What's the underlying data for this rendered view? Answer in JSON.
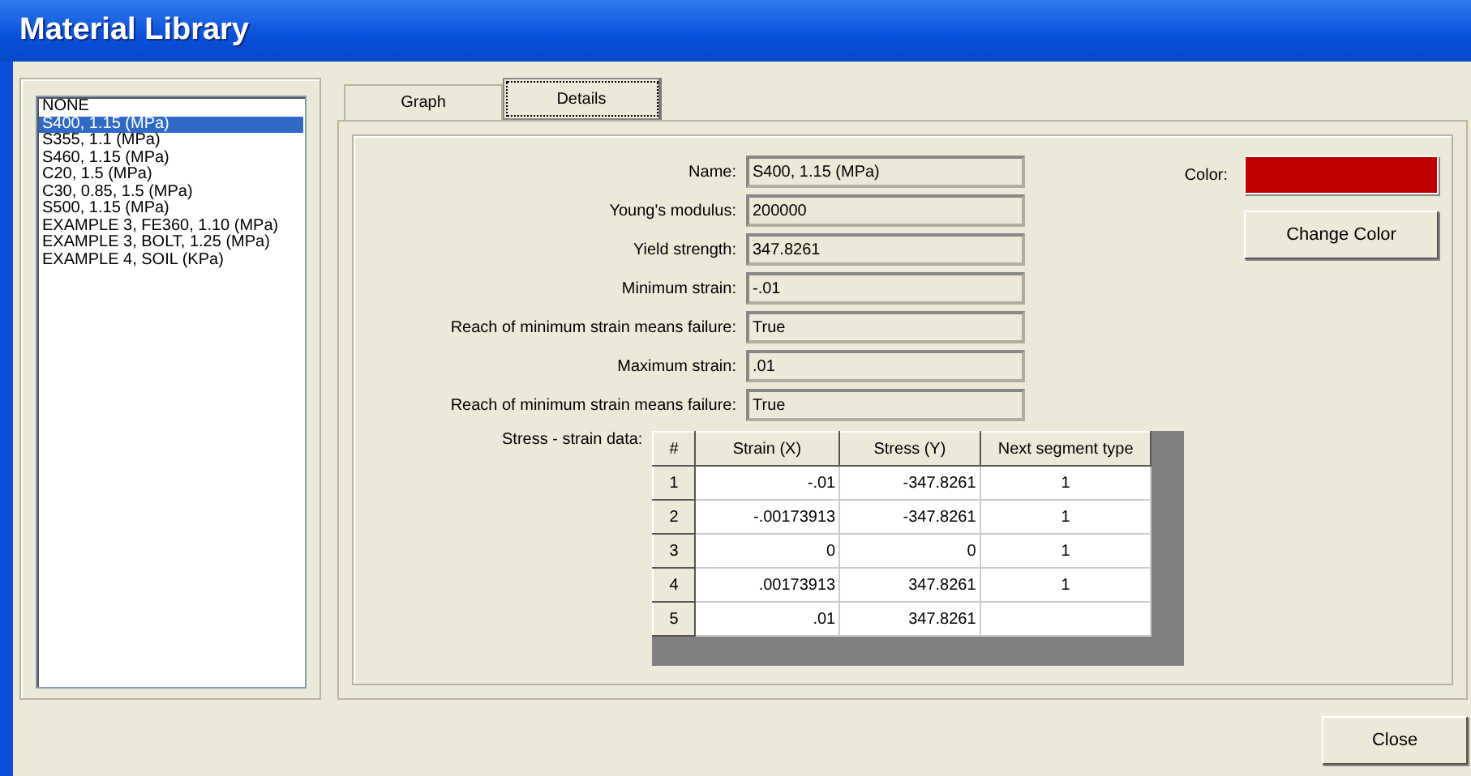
{
  "window": {
    "title": "Material Library"
  },
  "materials": [
    {
      "label": "NONE",
      "selected": false
    },
    {
      "label": "S400, 1.15 (MPa)",
      "selected": true
    },
    {
      "label": "S355, 1.1 (MPa)",
      "selected": false
    },
    {
      "label": "S460, 1.15 (MPa)",
      "selected": false
    },
    {
      "label": "C20, 1.5 (MPa)",
      "selected": false
    },
    {
      "label": "C30, 0.85, 1.5 (MPa)",
      "selected": false
    },
    {
      "label": "S500, 1.15 (MPa)",
      "selected": false
    },
    {
      "label": "EXAMPLE 3, FE360, 1.10 (MPa)",
      "selected": false
    },
    {
      "label": "EXAMPLE 3, BOLT, 1.25 (MPa)",
      "selected": false
    },
    {
      "label": "EXAMPLE 4, SOIL (KPa)",
      "selected": false
    }
  ],
  "tabs": [
    {
      "label": "Graph",
      "selected": false
    },
    {
      "label": "Details",
      "selected": true
    }
  ],
  "details": {
    "fields": [
      {
        "label": "Name:",
        "value": "S400, 1.15 (MPa)"
      },
      {
        "label": "Young's modulus:",
        "value": "200000"
      },
      {
        "label": "Yield strength:",
        "value": "347.8261"
      },
      {
        "label": "Minimum strain:",
        "value": "-.01"
      },
      {
        "label": "Reach of minimum strain means failure:",
        "value": "True"
      },
      {
        "label": "Maximum strain:",
        "value": ".01"
      },
      {
        "label": "Reach of minimum strain means failure:",
        "value": "True"
      }
    ],
    "color_label": "Color:",
    "color": "#c00000",
    "change_color_button": "Change Color",
    "table_label": "Stress - strain data:",
    "table": {
      "columns": [
        "#",
        "Strain (X)",
        "Stress (Y)",
        "Next segment type"
      ],
      "rows": [
        [
          "1",
          "-.01",
          "-347.8261",
          "1"
        ],
        [
          "2",
          "-.00173913",
          "-347.8261",
          "1"
        ],
        [
          "3",
          "0",
          "0",
          "1"
        ],
        [
          "4",
          ".00173913",
          "347.8261",
          "1"
        ],
        [
          "5",
          ".01",
          "347.8261"
        ]
      ]
    }
  },
  "buttons": [
    "Close"
  ]
}
